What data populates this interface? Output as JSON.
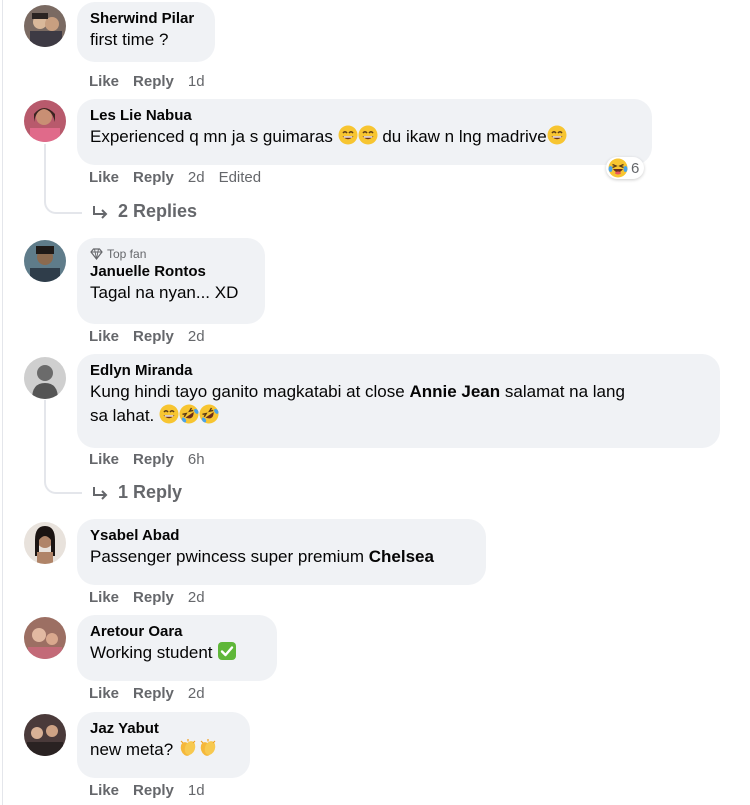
{
  "actions": {
    "like": "Like",
    "reply": "Reply"
  },
  "comments": [
    {
      "author": "Sherwind Pilar",
      "text": "first time ?",
      "time": "1d"
    },
    {
      "author": "Les Lie Nabua",
      "text": "Experienced q mn ja s guimaras",
      "text_after": "du ikaw n lng madrive",
      "time": "2d",
      "edited": "Edited",
      "reaction_count": "6",
      "replies": "2 Replies"
    },
    {
      "badge": "Top fan",
      "author": "Januelle Rontos",
      "text": "Tagal na nyan... XD",
      "time": "2d"
    },
    {
      "author": "Edlyn Miranda",
      "text_line1_a": "Kung hindi tayo ganito magkatabi at close",
      "mention": "Annie Jean",
      "text_line1_b": "salamat na lang",
      "text_line2": "sa lahat.",
      "time": "6h",
      "replies": "1 Reply"
    },
    {
      "author": "Ysabel Abad",
      "text": "Passenger pwincess super premium",
      "mention": "Chelsea",
      "time": "2d"
    },
    {
      "author": "Aretour Oara",
      "text": "Working student",
      "time": "2d"
    },
    {
      "author": "Jaz Yabut",
      "text": "new meta?",
      "time": "1d"
    }
  ],
  "icons": {
    "grin": "grinning-squinting-emoji",
    "laugh": "laughing-tears-emoji",
    "rofl": "rolling-laughing-emoji",
    "check": "check-mark-button-emoji",
    "clap": "clapping-hands-emoji",
    "reply_arrow": "reply-arrow-icon",
    "topfan": "top-fan-diamond-icon"
  },
  "colors": {
    "bubble": "#f0f2f5",
    "meta": "#65676b",
    "text": "#050505"
  }
}
